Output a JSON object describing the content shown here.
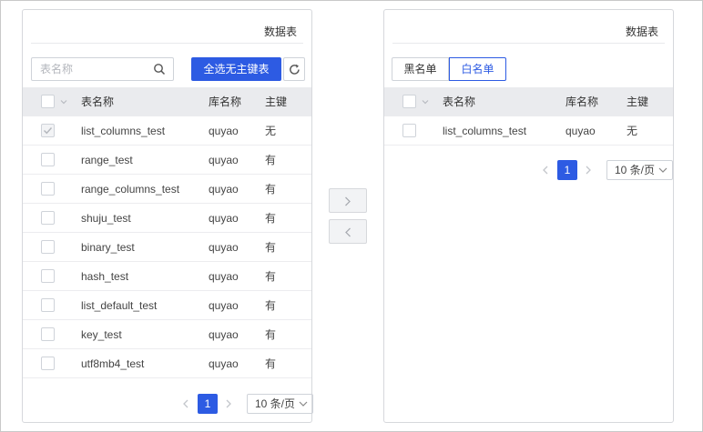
{
  "left_panel": {
    "title": "数据表",
    "search_placeholder": "表名称",
    "select_all_label": "全选无主键表",
    "columns": {
      "name": "表名称",
      "db": "库名称",
      "pk": "主键"
    },
    "rows": [
      {
        "name": "list_columns_test",
        "db": "quyao",
        "pk": "无",
        "checked": true
      },
      {
        "name": "range_test",
        "db": "quyao",
        "pk": "有",
        "checked": false
      },
      {
        "name": "range_columns_test",
        "db": "quyao",
        "pk": "有",
        "checked": false
      },
      {
        "name": "shuju_test",
        "db": "quyao",
        "pk": "有",
        "checked": false
      },
      {
        "name": "binary_test",
        "db": "quyao",
        "pk": "有",
        "checked": false
      },
      {
        "name": "hash_test",
        "db": "quyao",
        "pk": "有",
        "checked": false
      },
      {
        "name": "list_default_test",
        "db": "quyao",
        "pk": "有",
        "checked": false
      },
      {
        "name": "key_test",
        "db": "quyao",
        "pk": "有",
        "checked": false
      },
      {
        "name": "utf8mb4_test",
        "db": "quyao",
        "pk": "有",
        "checked": false
      }
    ],
    "pagination": {
      "page": "1",
      "page_size": "10 条/页"
    }
  },
  "right_panel": {
    "title": "数据表",
    "tabs": {
      "blacklist": "黑名单",
      "whitelist": "白名单"
    },
    "active_tab": "whitelist",
    "columns": {
      "name": "表名称",
      "db": "库名称",
      "pk": "主键"
    },
    "rows": [
      {
        "name": "list_columns_test",
        "db": "quyao",
        "pk": "无",
        "checked": false
      }
    ],
    "pagination": {
      "page": "1",
      "page_size": "10 条/页"
    }
  },
  "transfer": {
    "to_right_icon": "chevron-right-icon",
    "to_left_icon": "chevron-left-icon"
  },
  "colors": {
    "primary": "#2d5be3",
    "header_bg": "#eaebee",
    "border": "#d6d8dc"
  }
}
